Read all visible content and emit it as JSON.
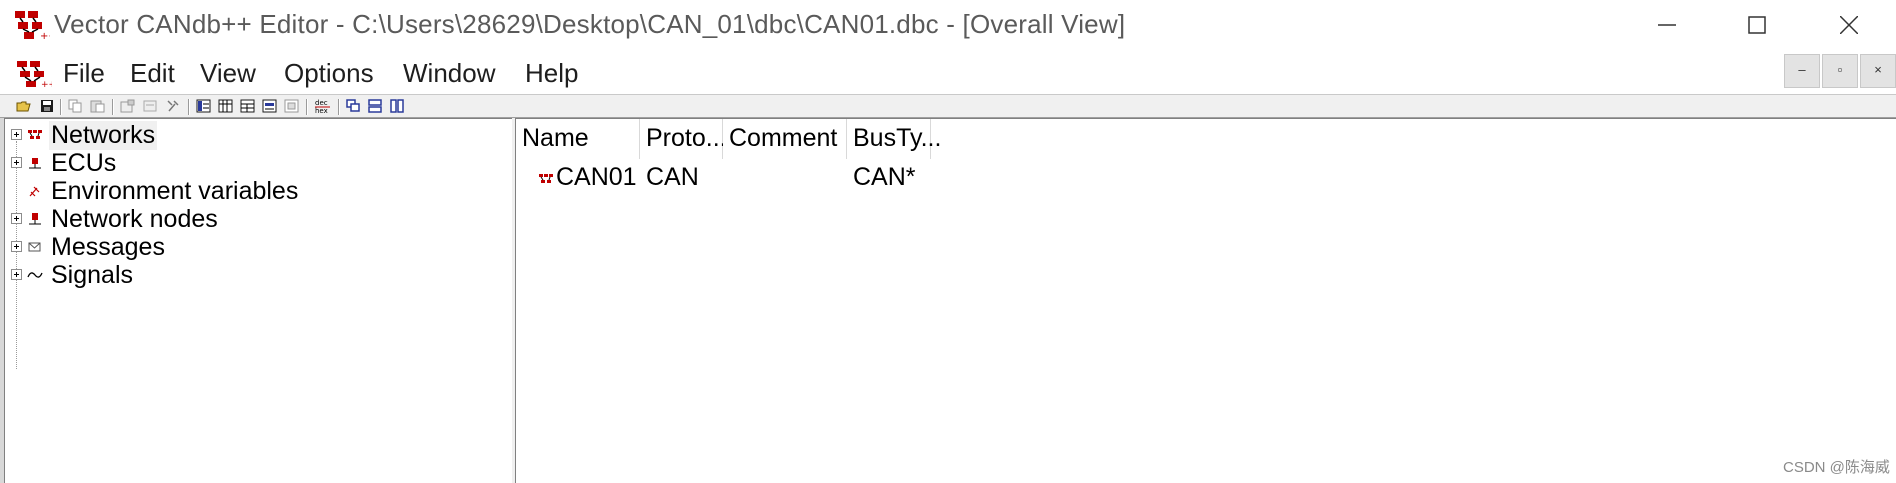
{
  "window": {
    "title": "Vector CANdb++ Editor - C:\\Users\\28629\\Desktop\\CAN_01\\dbc\\CAN01.dbc - [Overall View]",
    "app_icon": "vector-candb-icon",
    "controls": {
      "minimize": "minimize-icon",
      "maximize": "maximize-icon",
      "close": "close-icon"
    }
  },
  "menu": {
    "items": [
      "File",
      "Edit",
      "View",
      "Options",
      "Window",
      "Help"
    ],
    "mdi_controls": {
      "minimize": "–",
      "restore": "▫",
      "close": "×"
    }
  },
  "toolbar": {
    "icons": [
      "open-folder-icon",
      "save-icon",
      "copy-icon",
      "paste-icon",
      "properties-icon",
      "new-object-icon",
      "tools-icon",
      "table-view-icon",
      "list-view-icon",
      "grid-view-icon",
      "form-view-icon",
      "preview-icon",
      "dec-hex-icon",
      "cascade-icon",
      "tile-horizontal-icon",
      "tile-vertical-icon"
    ]
  },
  "tree": {
    "items": [
      {
        "label": "Networks",
        "expandable": true,
        "icon": "network-icon",
        "selected": true
      },
      {
        "label": "ECUs",
        "expandable": true,
        "icon": "ecu-icon",
        "selected": false
      },
      {
        "label": "Environment variables",
        "expandable": false,
        "icon": "env-variable-icon",
        "selected": false
      },
      {
        "label": "Network nodes",
        "expandable": true,
        "icon": "node-icon",
        "selected": false
      },
      {
        "label": "Messages",
        "expandable": true,
        "icon": "message-icon",
        "selected": false
      },
      {
        "label": "Signals",
        "expandable": true,
        "icon": "signal-icon",
        "selected": false
      }
    ]
  },
  "list": {
    "columns": [
      "Name",
      "Proto...",
      "Comment",
      "BusTy..."
    ],
    "rows": [
      {
        "name": "CAN01",
        "protocol": "CAN",
        "comment": "",
        "bustype": "CAN*",
        "icon": "network-icon"
      }
    ]
  },
  "watermark": "CSDN @陈海威",
  "colors": {
    "icon_red": "#c00000",
    "toolbar_bg": "#f0f0f0",
    "title_text": "#5a5a5a"
  }
}
